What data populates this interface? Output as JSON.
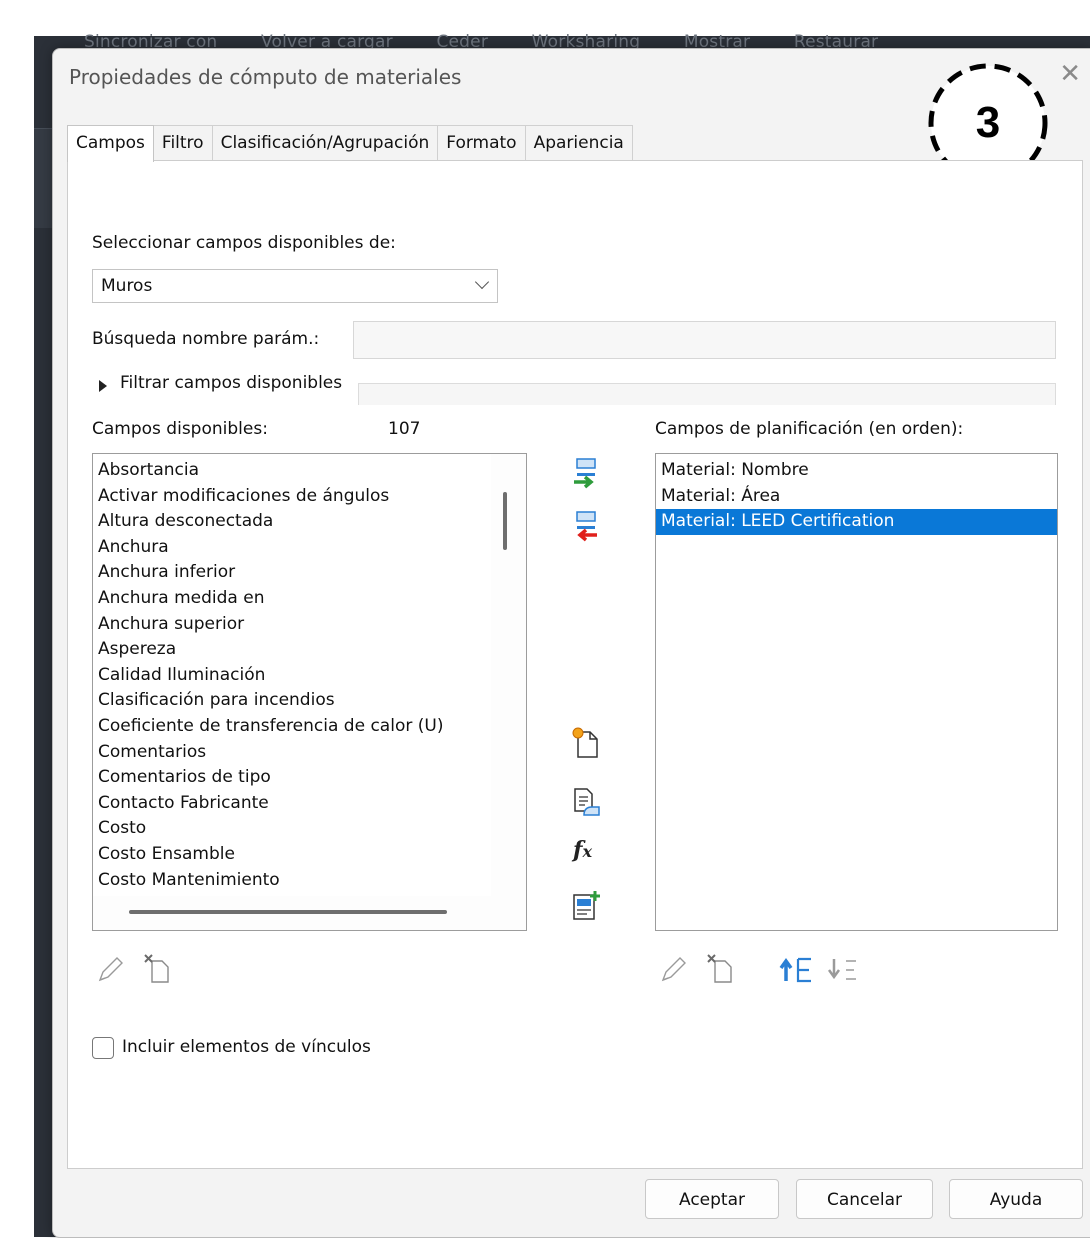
{
  "background_app": {
    "ribbon_items": [
      "Sincronizar con",
      "Volver a cargar",
      "Ceder",
      "Worksharing",
      "Mostrar",
      "Restaurar"
    ]
  },
  "dialog": {
    "title": "Propiedades de cómputo de materiales",
    "step_badge": "3",
    "tabs": [
      {
        "label": "Campos",
        "active": true
      },
      {
        "label": "Filtro",
        "active": false
      },
      {
        "label": "Clasificación/Agrupación",
        "active": false
      },
      {
        "label": "Formato",
        "active": false
      },
      {
        "label": "Apariencia",
        "active": false
      }
    ]
  },
  "fields_tab": {
    "select_label": "Seleccionar campos disponibles de:",
    "select_value": "Muros",
    "search_label": "Búsqueda nombre parám.:",
    "search_value": "",
    "filter_label": "Filtrar campos disponibles",
    "available_label": "Campos disponibles:",
    "available_count": "107",
    "scheduled_label": "Campos de planificación (en orden):",
    "available_fields": [
      "Absortancia",
      "Activar modificaciones de ángulos",
      "Altura desconectada",
      "Anchura",
      "Anchura inferior",
      "Anchura medida en",
      "Anchura superior",
      "Aspereza",
      "Calidad Iluminación",
      "Clasificación para incendios",
      "Coeficiente de transferencia de calor (U)",
      "Comentarios",
      "Comentarios de tipo",
      "Contacto Fabricante",
      "Costo",
      "Costo Ensamble",
      "Costo Mantenimiento"
    ],
    "scheduled_fields": [
      {
        "label": "Material: Nombre",
        "selected": false
      },
      {
        "label": "Material: Área",
        "selected": false
      },
      {
        "label": "Material: LEED Certification",
        "selected": true
      }
    ],
    "include_links_label": "Incluir elementos de vínculos",
    "include_links_checked": false
  },
  "footer": {
    "ok_label": "Aceptar",
    "cancel_label": "Cancelar",
    "help_label": "Ayuda"
  },
  "colors": {
    "selection": "#0a78d7",
    "add_arrow": "#2e9c3c",
    "remove_arrow": "#e0201c",
    "icon_blue": "#2a7fd4"
  }
}
